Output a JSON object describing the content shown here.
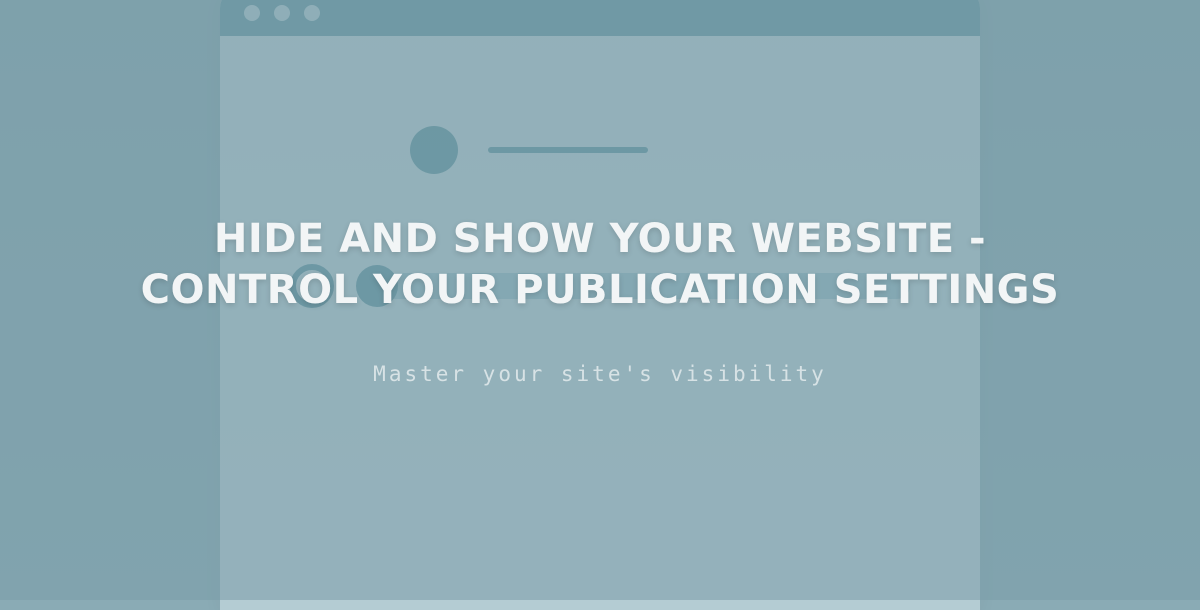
{
  "hero": {
    "headline": "HIDE AND SHOW YOUR WEBSITE - CONTROL YOUR PUBLICATION SETTINGS",
    "subline": "Master your site's visibility"
  }
}
